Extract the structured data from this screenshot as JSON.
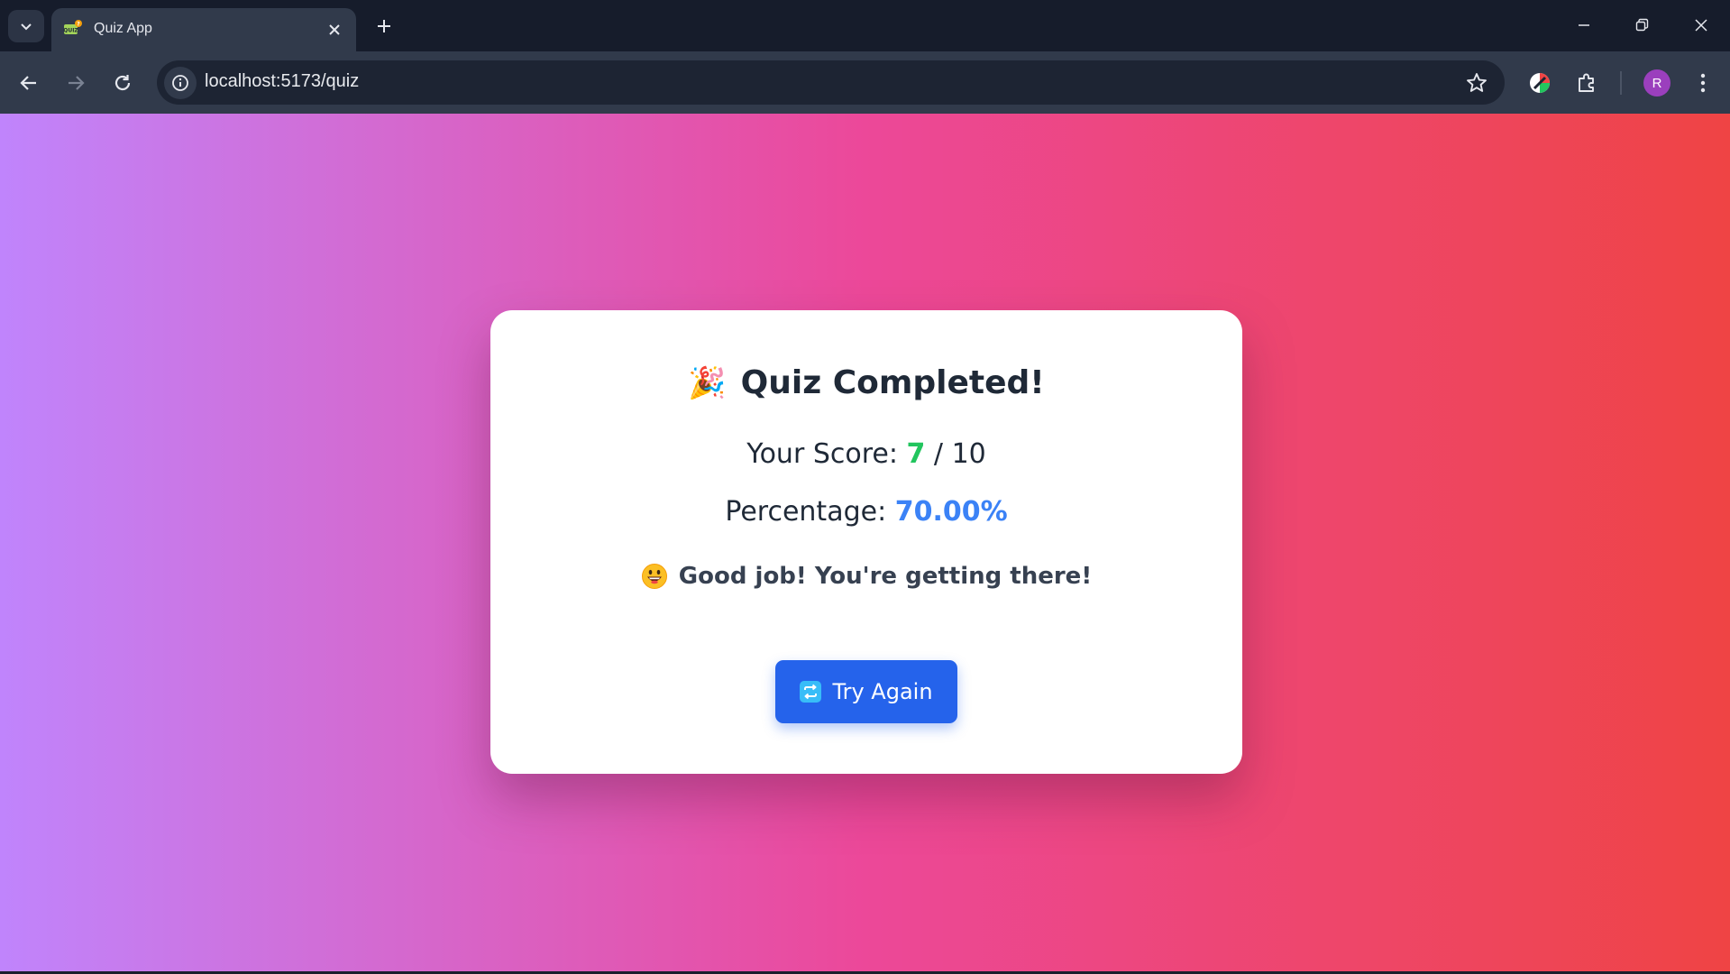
{
  "browser": {
    "tab_title": "Quiz App",
    "url": "localhost:5173/quiz",
    "profile_initial": "R"
  },
  "icons": {
    "tab_search": "chevron-down-icon",
    "tab_favicon": "quiz-favicon-icon",
    "tab_close": "close-icon",
    "new_tab": "plus-icon",
    "back": "back-arrow-icon",
    "forward": "forward-arrow-icon",
    "reload": "reload-icon",
    "site_info": "info-icon",
    "bookmark": "star-icon",
    "extension_1": "colorful-extension-icon",
    "extensions": "puzzle-icon",
    "menu": "kebab-menu-icon"
  },
  "result": {
    "heading": "Quiz Completed!",
    "heading_emoji": "🎉",
    "score_label": "Your Score:",
    "score_value": "7",
    "score_total": "/ 10",
    "percentage_label": "Percentage:",
    "percentage_value": "70.00%",
    "feedback": "Good job! You're getting there!",
    "try_again_label": "Try Again"
  },
  "colors": {
    "gradient_start": "#c084fc",
    "gradient_mid": "#ec4899",
    "gradient_end": "#ef4444",
    "score_color": "#22c55e",
    "percentage_color": "#3b82f6",
    "button_color": "#2563eb"
  }
}
